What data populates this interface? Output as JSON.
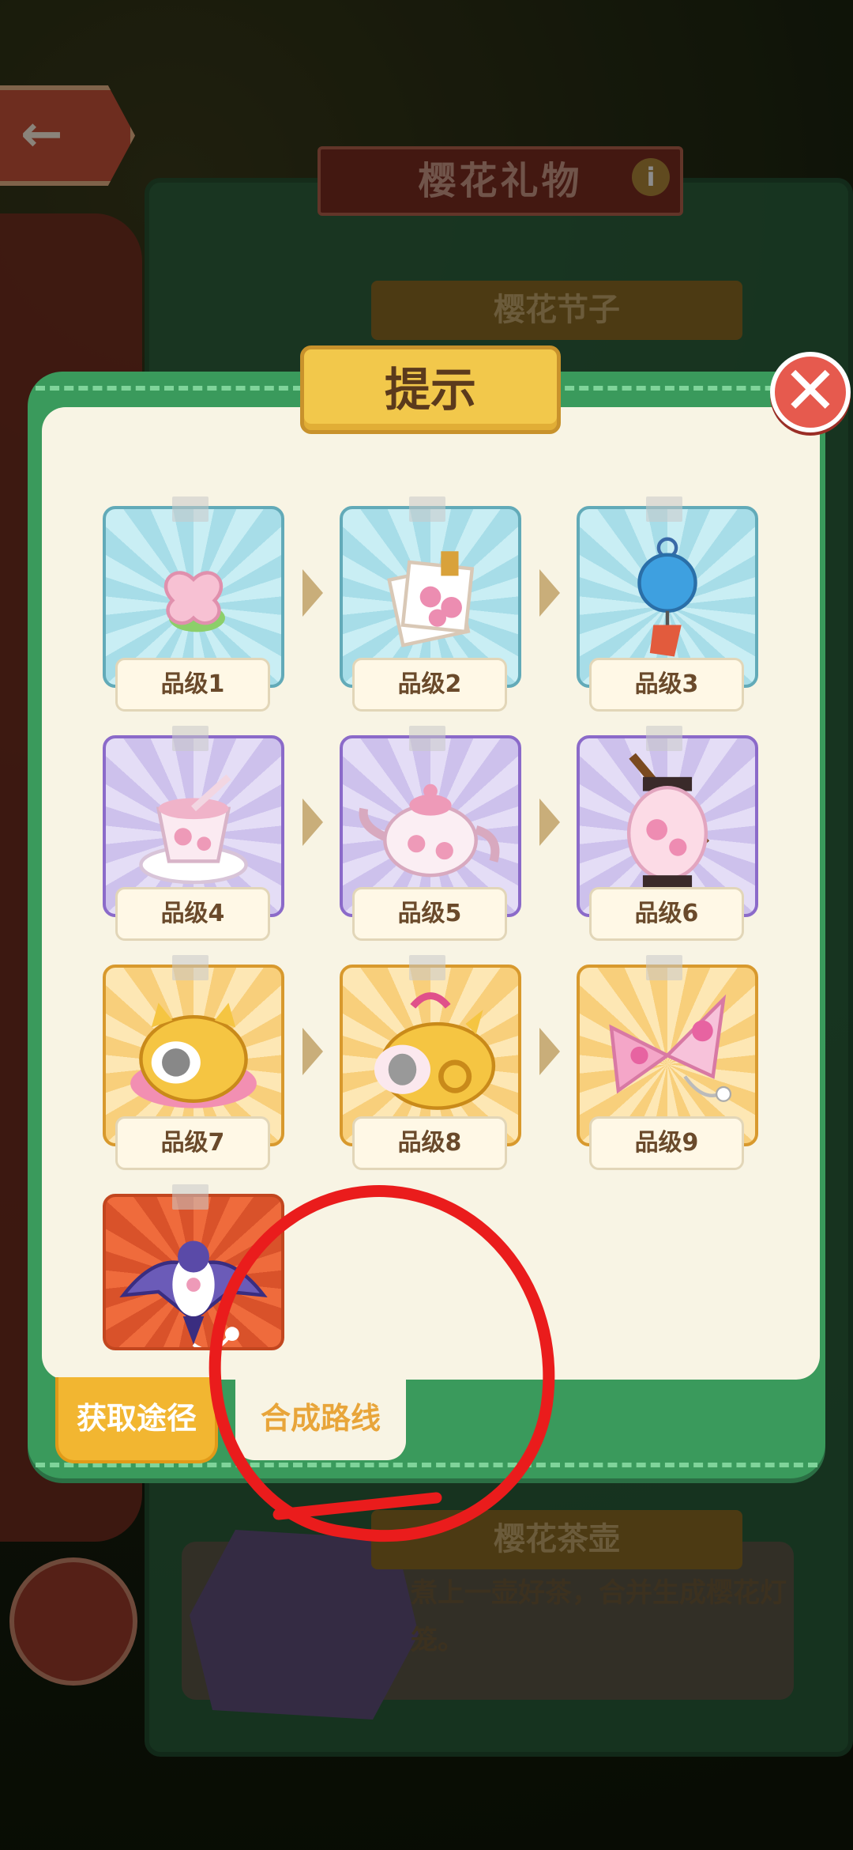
{
  "background": {
    "panel_title": "樱花礼物",
    "info_icon": "i",
    "sub_title_top": "樱花节子",
    "sub_title_bottom": "樱花茶壶",
    "card_desc": "煮上一壶好茶，合并生成樱花灯笼。",
    "back_icon": "arrow-left-icon"
  },
  "popup": {
    "title": "提示",
    "close_symbol": "✕",
    "items": [
      {
        "label": "品级1",
        "color": "blue",
        "icon": "sakura-petal-icon"
      },
      {
        "label": "品级2",
        "color": "blue",
        "icon": "sakura-note-icon"
      },
      {
        "label": "品级3",
        "color": "blue",
        "icon": "wind-chime-icon"
      },
      {
        "label": "品级4",
        "color": "purple",
        "icon": "tea-cup-icon"
      },
      {
        "label": "品级5",
        "color": "purple",
        "icon": "teapot-icon"
      },
      {
        "label": "品级6",
        "color": "purple",
        "icon": "lantern-icon"
      },
      {
        "label": "品级7",
        "color": "gold",
        "icon": "cat-house-icon"
      },
      {
        "label": "品级8",
        "color": "gold",
        "icon": "cat-bag-icon"
      },
      {
        "label": "品级9",
        "color": "gold",
        "icon": "butterfly-kite-icon"
      },
      {
        "label": "",
        "color": "orange",
        "icon": "bird-kite-icon"
      }
    ],
    "tabs": {
      "get": "获取途径",
      "route": "合成路线"
    }
  },
  "colors": {
    "popup_green": "#3a9a5c",
    "title_yellow": "#f2c84b",
    "annotation_red": "#ea1c1c"
  }
}
